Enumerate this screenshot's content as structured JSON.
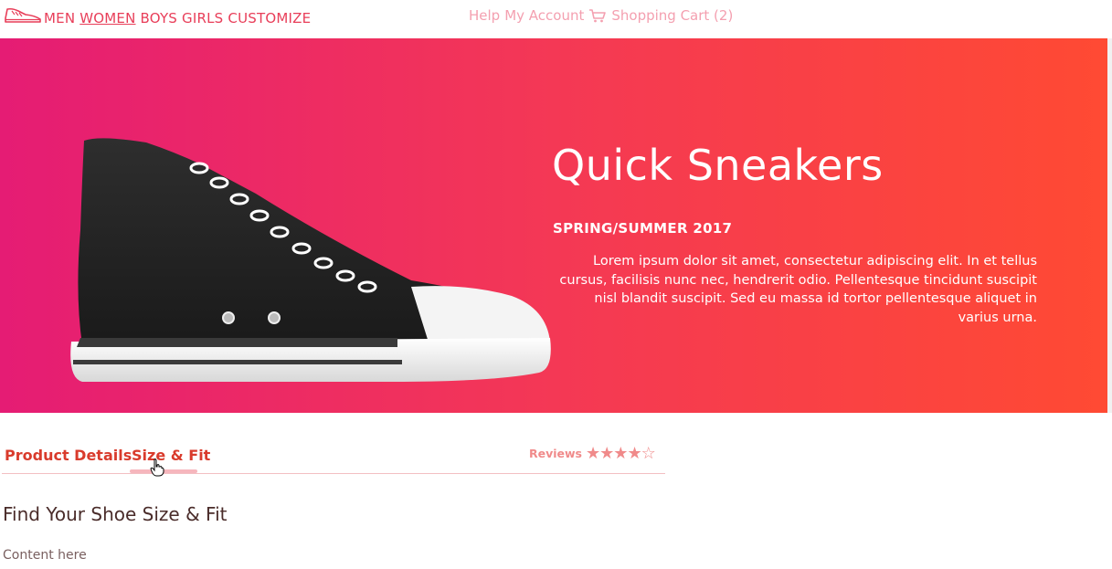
{
  "nav": {
    "left_items": [
      "MEN",
      "WOMEN",
      "BOYS",
      "GIRLS",
      "CUSTOMIZE"
    ],
    "active_item": "WOMEN",
    "help": "Help",
    "account": "My Account",
    "cart": "Shopping Cart (2)"
  },
  "hero": {
    "title": "Quick Sneakers",
    "subtitle": "SPRING/SUMMER 2017",
    "description": "Lorem ipsum dolor sit amet, consectetur adipiscing elit. In et tellus cursus, facilisis nunc nec, hendrerit odio. Pellentesque tincidunt suscipit nisl blandit suscipit. Sed eu massa id tortor pellentesque aliquet in varius urna."
  },
  "tabs": {
    "product_details": "Product Details",
    "size_fit": "Size & Fit",
    "active": "Size & Fit",
    "reviews_label": "Reviews",
    "rating": 4,
    "rating_max": 5
  },
  "section": {
    "title": "Find Your Shoe Size & Fit",
    "content": "Content here"
  },
  "colors": {
    "brand": "#e83e59",
    "gradient_start": "#e51c74",
    "gradient_end": "#ff4a33",
    "tab_text": "#d93b2c",
    "muted_pink": "#f4a0b0"
  }
}
